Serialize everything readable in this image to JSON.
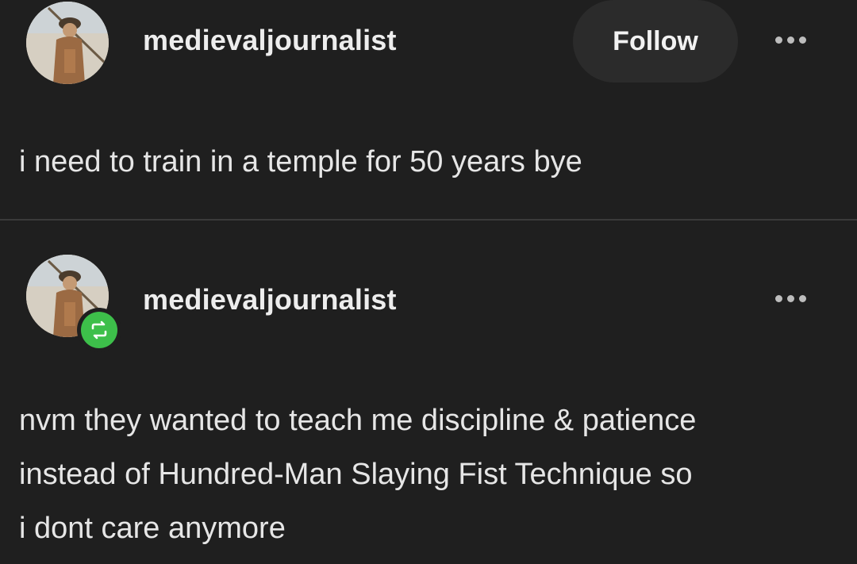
{
  "posts": [
    {
      "username": "medievaljournalist",
      "follow_label": "Follow",
      "text_lines": [
        "i need to train in a temple for 50 years bye"
      ]
    },
    {
      "username": "medievaljournalist",
      "reblog_icon": "reblog-icon",
      "text_lines": [
        "nvm they wanted to teach me discipline & patience",
        "instead of Hundred-Man Slaying Fist Technique so",
        "i dont care anymore"
      ]
    }
  ],
  "icons": {
    "more": "more-options-icon",
    "reblog": "reblog-icon"
  },
  "colors": {
    "background": "#1f1f1f",
    "follow_button": "#2b2b2b",
    "reblog_badge": "#3dbf4a"
  }
}
